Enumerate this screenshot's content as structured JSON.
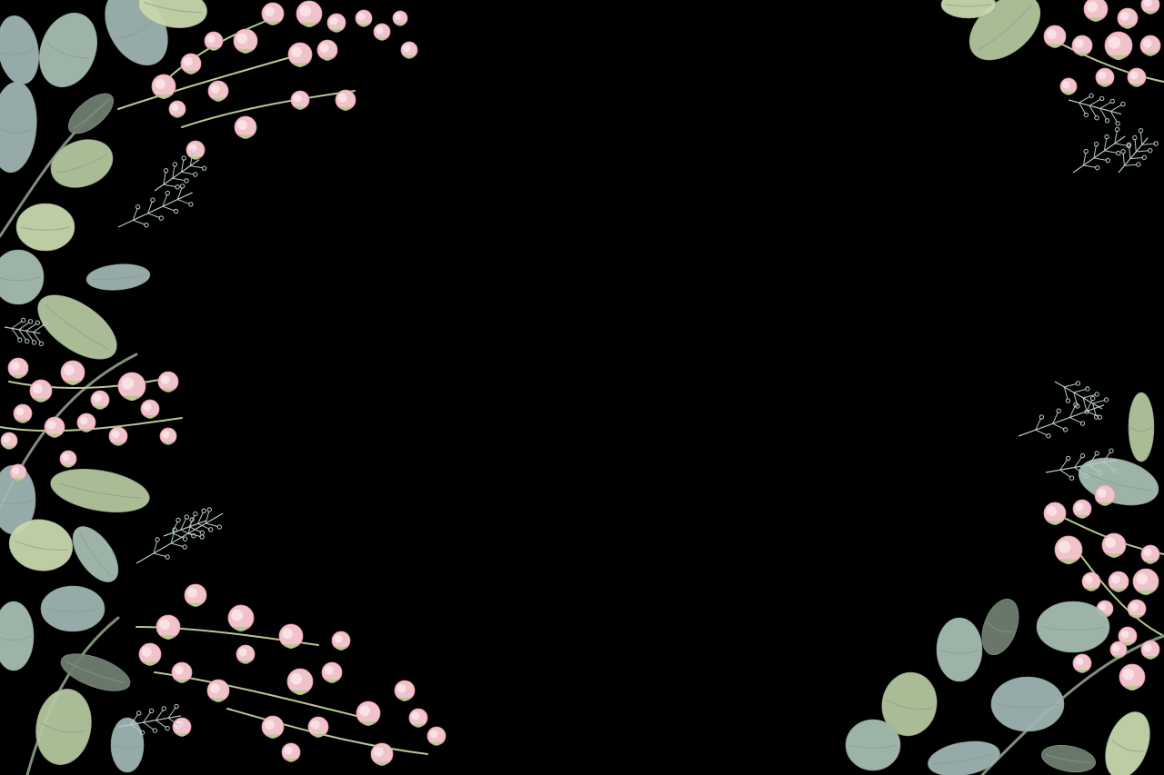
{
  "background_color": "#000000",
  "palette": {
    "leaf_light": "#c9d7ad",
    "leaf_mid": "#b4c79d",
    "leaf_sage": "#a6bdb0",
    "leaf_blue": "#9fb5b3",
    "leaf_dark": "#6e7e6f",
    "stem": "#b7c98e",
    "bud_pink": "#f0c3cb",
    "bud_deep": "#e48fa5",
    "bud_light": "#fbe6ea",
    "sprig_gray": "#b9c9c9"
  },
  "icons": [
    "eucalyptus-leaf-icon",
    "rose-bud-icon",
    "gypsophila-sprig-icon"
  ]
}
